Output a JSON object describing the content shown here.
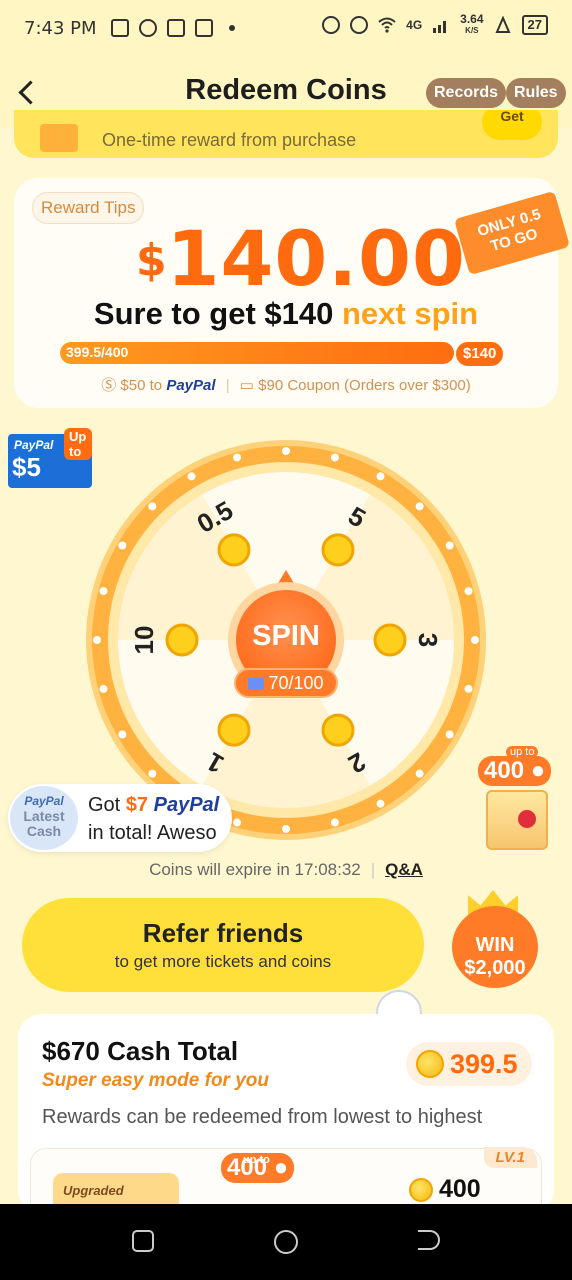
{
  "status_bar": {
    "time": "7:43 PM",
    "network": "4G",
    "speed": "3.64",
    "speed_unit": "K/S",
    "battery": "27"
  },
  "header": {
    "title": "Redeem Coins",
    "records_label": "Records",
    "rules_label": "Rules"
  },
  "promo": {
    "text": "One-time reward from purchase",
    "button_label": "Get"
  },
  "reward_card": {
    "tips_label": "Reward Tips",
    "currency": "$",
    "amount": "140.00",
    "only_line1": "ONLY 0.5",
    "only_line2": "TO GO",
    "sure_text": "Sure to get $140",
    "sure_highlight": "next spin",
    "progress_label": "399.5/400",
    "progress_fraction": 0.9988,
    "target_label": "$140",
    "paypal_prefix": "$50 to",
    "paypal_brand": "PayPal",
    "coupon_text": "$90 Coupon (Orders over $300)"
  },
  "paypal_badge": {
    "brand": "PayPal",
    "amount": "$5",
    "upto": "Up to"
  },
  "wheel": {
    "segments": [
      "0.5",
      "5",
      "3",
      "2",
      "1",
      "10"
    ],
    "spin_label": "SPIN",
    "tickets": "70/100"
  },
  "chest": {
    "upto": "up to",
    "value": "400"
  },
  "toast": {
    "avatar_brand": "PayPal",
    "avatar_text": "Latest Cash",
    "got": "Got",
    "amount": "$7",
    "brand": "PayPal",
    "line2": "in total! Aweso"
  },
  "expire": {
    "text": "Coins will expire in 17:08:32",
    "qa_label": "Q&A"
  },
  "refer": {
    "title": "Refer friends",
    "subtitle": "to get more tickets and coins",
    "win_label": "WIN",
    "win_amount": "$2,000"
  },
  "cash_card": {
    "title": "$670 Cash Total",
    "subtitle": "Super easy mode for you",
    "coins": "399.5",
    "note": "Rewards can be redeemed from lowest to highest",
    "upgraded_label": "Upgraded",
    "tier_upto": "up to",
    "tier_value": "400",
    "level_label": "LV.1",
    "tier_coins": "400"
  },
  "colors": {
    "accent_orange": "#ff6a0e",
    "accent_yellow": "#ffe03a",
    "background": "#fff7cf",
    "paypal_blue": "#1f3f9c"
  }
}
